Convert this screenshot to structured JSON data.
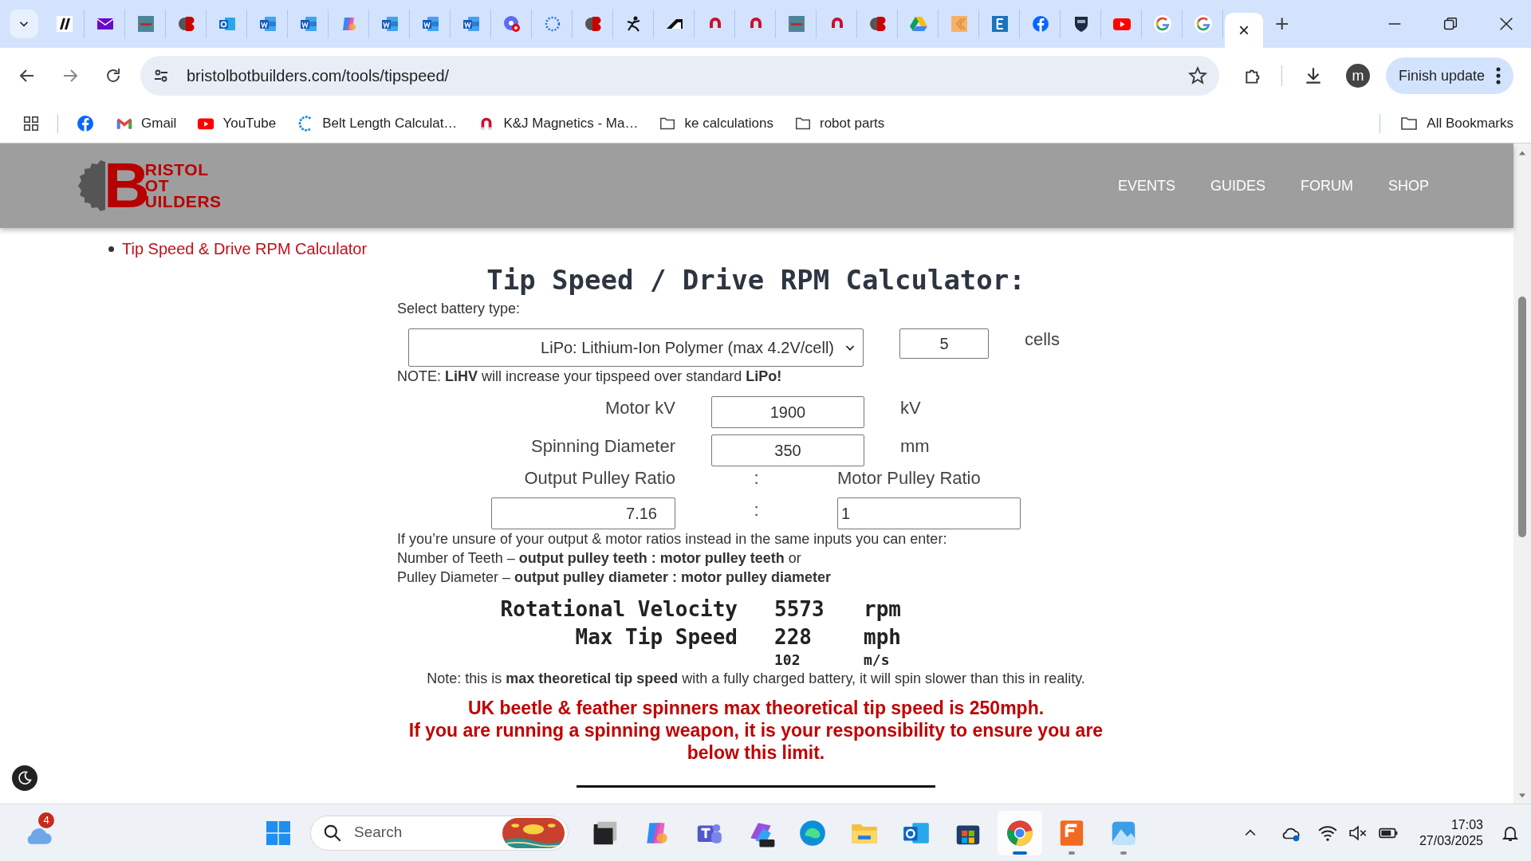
{
  "browser": {
    "tabs": [
      {
        "kind": "slash",
        "selected": false
      },
      {
        "kind": "mail",
        "selected": false
      },
      {
        "kind": "em",
        "selected": false
      },
      {
        "kind": "bb",
        "selected": false
      },
      {
        "kind": "outlook",
        "selected": false
      },
      {
        "kind": "word",
        "selected": false
      },
      {
        "kind": "word",
        "selected": false
      },
      {
        "kind": "copilot",
        "selected": false
      },
      {
        "kind": "word",
        "selected": false
      },
      {
        "kind": "word",
        "selected": false
      },
      {
        "kind": "word",
        "selected": false
      },
      {
        "kind": "gcircle",
        "selected": false
      },
      {
        "kind": "dots",
        "selected": false
      },
      {
        "kind": "bb",
        "selected": false
      },
      {
        "kind": "climb",
        "selected": false
      },
      {
        "kind": "wedge",
        "selected": false
      },
      {
        "kind": "magnet",
        "selected": false
      },
      {
        "kind": "magnet",
        "selected": false
      },
      {
        "kind": "em",
        "selected": false
      },
      {
        "kind": "magnet",
        "selected": false
      },
      {
        "kind": "bb",
        "selected": false
      },
      {
        "kind": "drive",
        "selected": false
      },
      {
        "kind": "kite",
        "selected": false
      },
      {
        "kind": "etile",
        "selected": false
      },
      {
        "kind": "facebook",
        "selected": false
      },
      {
        "kind": "shield",
        "selected": false
      },
      {
        "kind": "youtube",
        "selected": false
      },
      {
        "kind": "google",
        "selected": false
      },
      {
        "kind": "google",
        "selected": false
      },
      {
        "kind": "blank",
        "selected": true
      }
    ],
    "tab_close": "×",
    "new_tab": "+",
    "address": "bristolbotbuilders.com/tools/tipspeed/",
    "profile_initial": "m",
    "update_button": "Finish update",
    "bookmarks": [
      {
        "kind": "facebook"
      },
      {
        "kind": "gmail",
        "label": "Gmail"
      },
      {
        "kind": "youtube",
        "label": "YouTube"
      },
      {
        "kind": "belt",
        "label": "Belt Length Calculat…"
      },
      {
        "kind": "magnet",
        "label": "K&J Magnetics - Ma…"
      },
      {
        "kind": "folder",
        "label": "ke calculations"
      },
      {
        "kind": "folder",
        "label": "robot parts"
      }
    ],
    "all_bookmarks": "All Bookmarks"
  },
  "site": {
    "logo": {
      "initial": "B",
      "lines": [
        "RISTOL",
        "OT",
        "UILDERS"
      ]
    },
    "nav": [
      "EVENTS",
      "GUIDES",
      "FORUM",
      "SHOP"
    ],
    "sidebar_link": "Tip Speed & Drive RPM Calculator"
  },
  "calculator": {
    "title": "Tip Speed / Drive RPM Calculator:",
    "battery_label": "Select battery type:",
    "battery_select": "LiPo: Lithium-Ion Polymer (max 4.2V/cell)",
    "cells_value": "5",
    "cells_unit": "cells",
    "note": "NOTE: **LiHV** will increase your tipspeed over standard **LiPo!**",
    "fields": [
      {
        "label": "Motor kV",
        "value": "1900",
        "unit": "kV"
      },
      {
        "label": "Spinning Diameter",
        "value": "350",
        "unit": "mm"
      }
    ],
    "ratio": {
      "output_label": "Output Pulley Ratio",
      "separator": ":",
      "motor_label": "Motor Pulley Ratio",
      "output_value": "7.16",
      "input_separator": ":",
      "motor_value": "1"
    },
    "help_lines": [
      "If you’re unsure of your output & motor ratios instead in the same inputs you can enter:",
      "Number of Teeth – **output pulley teeth : motor pulley teeth** or",
      "Pulley Diameter – **output pulley diameter : motor pulley diameter**"
    ],
    "results": [
      {
        "label": "Rotational Velocity",
        "value": "5573",
        "unit": "rpm"
      },
      {
        "label": "Max Tip Speed",
        "value": "228",
        "unit": "mph"
      }
    ],
    "extra_result": {
      "value": "102",
      "unit": "m/s"
    },
    "disclaimer": "Note: this is **max theoretical tip speed** with a fully charged battery, it will spin slower than this in reality.",
    "warnings": [
      "UK beetle & feather spinners max theoretical tip speed is 250mph.",
      "If you are running a spinning weapon, it is your responsibility to ensure you are",
      "below this limit."
    ]
  },
  "taskbar": {
    "weather_badge": "4",
    "search_placeholder": "Search",
    "apps": [
      {
        "kind": "files",
        "running": false,
        "selected": false
      },
      {
        "kind": "copilot",
        "running": false,
        "selected": false
      },
      {
        "kind": "teams",
        "running": false,
        "selected": false
      },
      {
        "kind": "m365",
        "running": false,
        "selected": false
      },
      {
        "kind": "edge",
        "running": false,
        "selected": false
      },
      {
        "kind": "explorer",
        "running": false,
        "selected": false
      },
      {
        "kind": "outlook",
        "running": false,
        "selected": false
      },
      {
        "kind": "store",
        "running": false,
        "selected": false
      },
      {
        "kind": "chrome",
        "running": true,
        "selected": true
      },
      {
        "kind": "fusion",
        "running": true,
        "selected": false
      },
      {
        "kind": "photos",
        "running": true,
        "selected": false
      }
    ],
    "time": "17:03",
    "date": "27/03/2025"
  }
}
